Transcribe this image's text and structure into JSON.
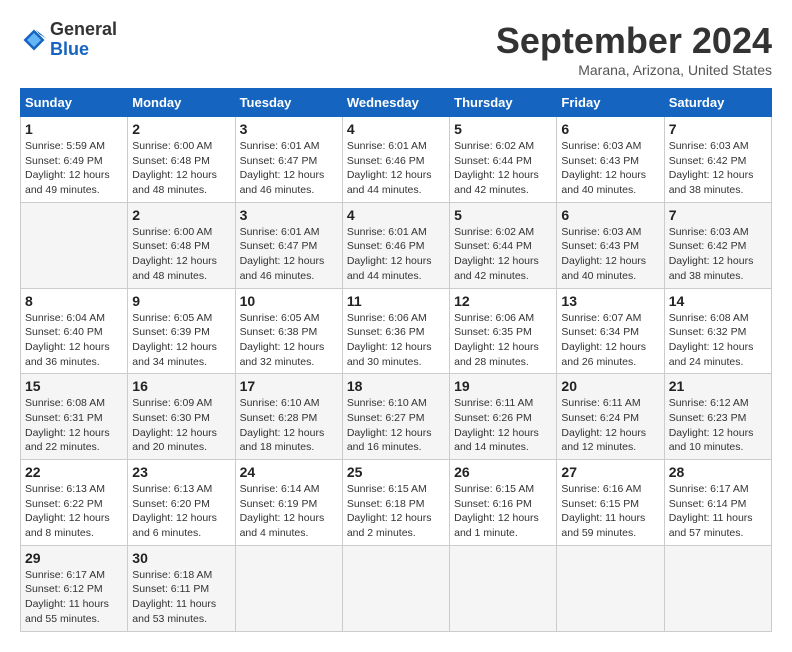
{
  "header": {
    "logo_line1": "General",
    "logo_line2": "Blue",
    "month_title": "September 2024",
    "location": "Marana, Arizona, United States"
  },
  "calendar": {
    "days_of_week": [
      "Sunday",
      "Monday",
      "Tuesday",
      "Wednesday",
      "Thursday",
      "Friday",
      "Saturday"
    ],
    "weeks": [
      [
        {
          "day": "",
          "detail": ""
        },
        {
          "day": "2",
          "detail": "Sunrise: 6:00 AM\nSunset: 6:48 PM\nDaylight: 12 hours\nand 48 minutes."
        },
        {
          "day": "3",
          "detail": "Sunrise: 6:01 AM\nSunset: 6:47 PM\nDaylight: 12 hours\nand 46 minutes."
        },
        {
          "day": "4",
          "detail": "Sunrise: 6:01 AM\nSunset: 6:46 PM\nDaylight: 12 hours\nand 44 minutes."
        },
        {
          "day": "5",
          "detail": "Sunrise: 6:02 AM\nSunset: 6:44 PM\nDaylight: 12 hours\nand 42 minutes."
        },
        {
          "day": "6",
          "detail": "Sunrise: 6:03 AM\nSunset: 6:43 PM\nDaylight: 12 hours\nand 40 minutes."
        },
        {
          "day": "7",
          "detail": "Sunrise: 6:03 AM\nSunset: 6:42 PM\nDaylight: 12 hours\nand 38 minutes."
        }
      ],
      [
        {
          "day": "8",
          "detail": "Sunrise: 6:04 AM\nSunset: 6:40 PM\nDaylight: 12 hours\nand 36 minutes."
        },
        {
          "day": "9",
          "detail": "Sunrise: 6:05 AM\nSunset: 6:39 PM\nDaylight: 12 hours\nand 34 minutes."
        },
        {
          "day": "10",
          "detail": "Sunrise: 6:05 AM\nSunset: 6:38 PM\nDaylight: 12 hours\nand 32 minutes."
        },
        {
          "day": "11",
          "detail": "Sunrise: 6:06 AM\nSunset: 6:36 PM\nDaylight: 12 hours\nand 30 minutes."
        },
        {
          "day": "12",
          "detail": "Sunrise: 6:06 AM\nSunset: 6:35 PM\nDaylight: 12 hours\nand 28 minutes."
        },
        {
          "day": "13",
          "detail": "Sunrise: 6:07 AM\nSunset: 6:34 PM\nDaylight: 12 hours\nand 26 minutes."
        },
        {
          "day": "14",
          "detail": "Sunrise: 6:08 AM\nSunset: 6:32 PM\nDaylight: 12 hours\nand 24 minutes."
        }
      ],
      [
        {
          "day": "15",
          "detail": "Sunrise: 6:08 AM\nSunset: 6:31 PM\nDaylight: 12 hours\nand 22 minutes."
        },
        {
          "day": "16",
          "detail": "Sunrise: 6:09 AM\nSunset: 6:30 PM\nDaylight: 12 hours\nand 20 minutes."
        },
        {
          "day": "17",
          "detail": "Sunrise: 6:10 AM\nSunset: 6:28 PM\nDaylight: 12 hours\nand 18 minutes."
        },
        {
          "day": "18",
          "detail": "Sunrise: 6:10 AM\nSunset: 6:27 PM\nDaylight: 12 hours\nand 16 minutes."
        },
        {
          "day": "19",
          "detail": "Sunrise: 6:11 AM\nSunset: 6:26 PM\nDaylight: 12 hours\nand 14 minutes."
        },
        {
          "day": "20",
          "detail": "Sunrise: 6:11 AM\nSunset: 6:24 PM\nDaylight: 12 hours\nand 12 minutes."
        },
        {
          "day": "21",
          "detail": "Sunrise: 6:12 AM\nSunset: 6:23 PM\nDaylight: 12 hours\nand 10 minutes."
        }
      ],
      [
        {
          "day": "22",
          "detail": "Sunrise: 6:13 AM\nSunset: 6:22 PM\nDaylight: 12 hours\nand 8 minutes."
        },
        {
          "day": "23",
          "detail": "Sunrise: 6:13 AM\nSunset: 6:20 PM\nDaylight: 12 hours\nand 6 minutes."
        },
        {
          "day": "24",
          "detail": "Sunrise: 6:14 AM\nSunset: 6:19 PM\nDaylight: 12 hours\nand 4 minutes."
        },
        {
          "day": "25",
          "detail": "Sunrise: 6:15 AM\nSunset: 6:18 PM\nDaylight: 12 hours\nand 2 minutes."
        },
        {
          "day": "26",
          "detail": "Sunrise: 6:15 AM\nSunset: 6:16 PM\nDaylight: 12 hours\nand 1 minute."
        },
        {
          "day": "27",
          "detail": "Sunrise: 6:16 AM\nSunset: 6:15 PM\nDaylight: 11 hours\nand 59 minutes."
        },
        {
          "day": "28",
          "detail": "Sunrise: 6:17 AM\nSunset: 6:14 PM\nDaylight: 11 hours\nand 57 minutes."
        }
      ],
      [
        {
          "day": "29",
          "detail": "Sunrise: 6:17 AM\nSunset: 6:12 PM\nDaylight: 11 hours\nand 55 minutes."
        },
        {
          "day": "30",
          "detail": "Sunrise: 6:18 AM\nSunset: 6:11 PM\nDaylight: 11 hours\nand 53 minutes."
        },
        {
          "day": "",
          "detail": ""
        },
        {
          "day": "",
          "detail": ""
        },
        {
          "day": "",
          "detail": ""
        },
        {
          "day": "",
          "detail": ""
        },
        {
          "day": "",
          "detail": ""
        }
      ]
    ],
    "first_row": [
      {
        "day": "1",
        "detail": "Sunrise: 5:59 AM\nSunset: 6:49 PM\nDaylight: 12 hours\nand 49 minutes."
      },
      {
        "day": "2",
        "detail": "Sunrise: 6:00 AM\nSunset: 6:48 PM\nDaylight: 12 hours\nand 48 minutes."
      },
      {
        "day": "3",
        "detail": "Sunrise: 6:01 AM\nSunset: 6:47 PM\nDaylight: 12 hours\nand 46 minutes."
      },
      {
        "day": "4",
        "detail": "Sunrise: 6:01 AM\nSunset: 6:46 PM\nDaylight: 12 hours\nand 44 minutes."
      },
      {
        "day": "5",
        "detail": "Sunrise: 6:02 AM\nSunset: 6:44 PM\nDaylight: 12 hours\nand 42 minutes."
      },
      {
        "day": "6",
        "detail": "Sunrise: 6:03 AM\nSunset: 6:43 PM\nDaylight: 12 hours\nand 40 minutes."
      },
      {
        "day": "7",
        "detail": "Sunrise: 6:03 AM\nSunset: 6:42 PM\nDaylight: 12 hours\nand 38 minutes."
      }
    ]
  }
}
